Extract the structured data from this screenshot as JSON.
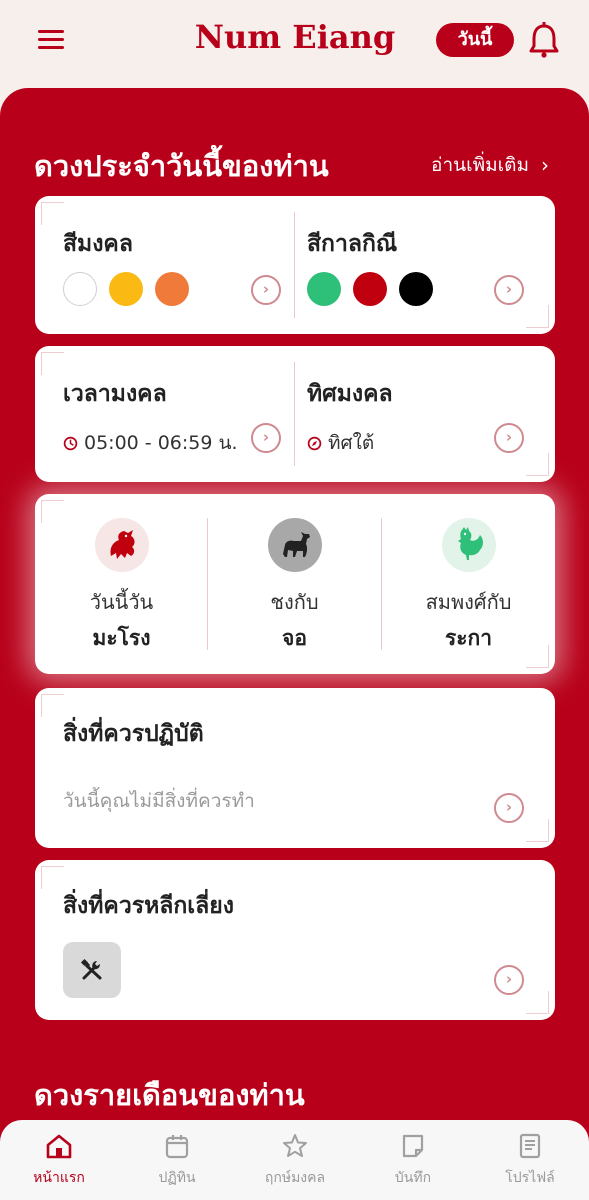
{
  "header": {
    "app_title": "Num Eiang",
    "today_label": "วันนี้",
    "accent": "#b8001a"
  },
  "daily": {
    "title": "ดวงประจำวันนี้ของท่าน",
    "read_more": "อ่านเพิ่มเติม"
  },
  "colors_card": {
    "lucky_label": "สีมงคล",
    "lucky_colors": [
      "#ffffff",
      "#fbb913",
      "#f07a3a"
    ],
    "unlucky_label": "สีกาลกิณี",
    "unlucky_colors": [
      "#2ebf78",
      "#c1000f",
      "#000000"
    ]
  },
  "time_card": {
    "time_label": "เวลามงคล",
    "time_value": "05:00 - 06:59 น.",
    "direction_label": "ทิศมงคล",
    "direction_value": "ทิศใต้"
  },
  "zodiac_card": {
    "today": {
      "label": "วันนี้วัน",
      "value": "มะโรง",
      "icon": "dragon-icon"
    },
    "clash": {
      "label": "ชงกับ",
      "value": "จอ",
      "icon": "dog-icon"
    },
    "harmony": {
      "label": "สมพงศ์กับ",
      "value": "ระกา",
      "icon": "rooster-icon"
    }
  },
  "dos_card": {
    "title": "สิ่งที่ควรปฏิบัติ",
    "empty_text": "วันนี้คุณไม่มีสิ่งที่ควรทำ"
  },
  "donts_card": {
    "title": "สิ่งที่ควรหลีกเลี่ยง",
    "icon": "tools-icon"
  },
  "monthly": {
    "title": "ดวงรายเดือนของท่าน"
  },
  "bottom_nav": [
    {
      "label": "หน้าแรก",
      "icon": "home-icon",
      "active": true
    },
    {
      "label": "ปฏิทิน",
      "icon": "calendar-icon",
      "active": false
    },
    {
      "label": "ฤกษ์มงคล",
      "icon": "star-icon",
      "active": false
    },
    {
      "label": "บันทึก",
      "icon": "note-icon",
      "active": false
    },
    {
      "label": "โปรไฟล์",
      "icon": "book-icon",
      "active": false
    }
  ]
}
